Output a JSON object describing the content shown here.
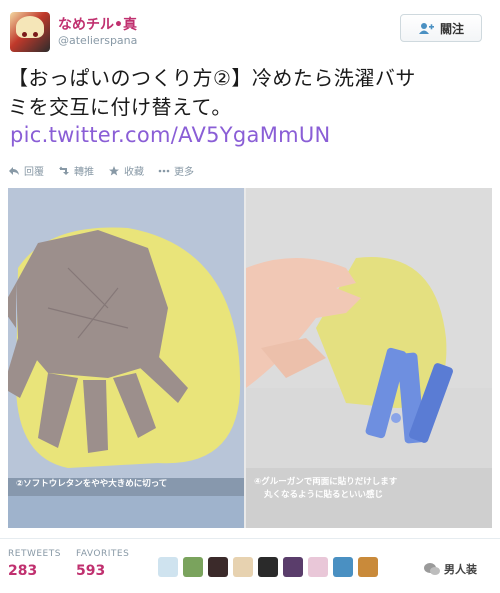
{
  "profile": {
    "display_name": "なめチル•真",
    "handle": "@atelierspana",
    "follow_label": "關注"
  },
  "tweet": {
    "text_line1": "【おっぱいのつくり方②】冷めたら洗濯バサ",
    "text_line2": "ミを交互に付け替えて。",
    "link": "pic.twitter.com/AV5YgaMmUN"
  },
  "actions": {
    "reply": "回覆",
    "retweet": "轉推",
    "favorite": "收藏",
    "more": "更多"
  },
  "media": {
    "caption_left": "②ソフトウレタンをやや大きめに切って",
    "caption_right_line1": "④グルーガンで両面に貼りだけします",
    "caption_right_line2": "丸くなるように貼るといい感じ"
  },
  "stats": {
    "retweets_label": "RETWEETS",
    "retweets_value": "283",
    "favorites_label": "FAVORITES",
    "favorites_value": "593"
  },
  "favoriters": [
    {
      "color": "#cfe3ef"
    },
    {
      "color": "#7aa35d"
    },
    {
      "color": "#3b2a2a"
    },
    {
      "color": "#e7d2b0"
    },
    {
      "color": "#2a2a2a"
    },
    {
      "color": "#5a3d6b"
    },
    {
      "color": "#e9c7d8"
    },
    {
      "color": "#4a90c2"
    },
    {
      "color": "#c98a3a"
    }
  ],
  "watermark": {
    "text": "男人装"
  }
}
